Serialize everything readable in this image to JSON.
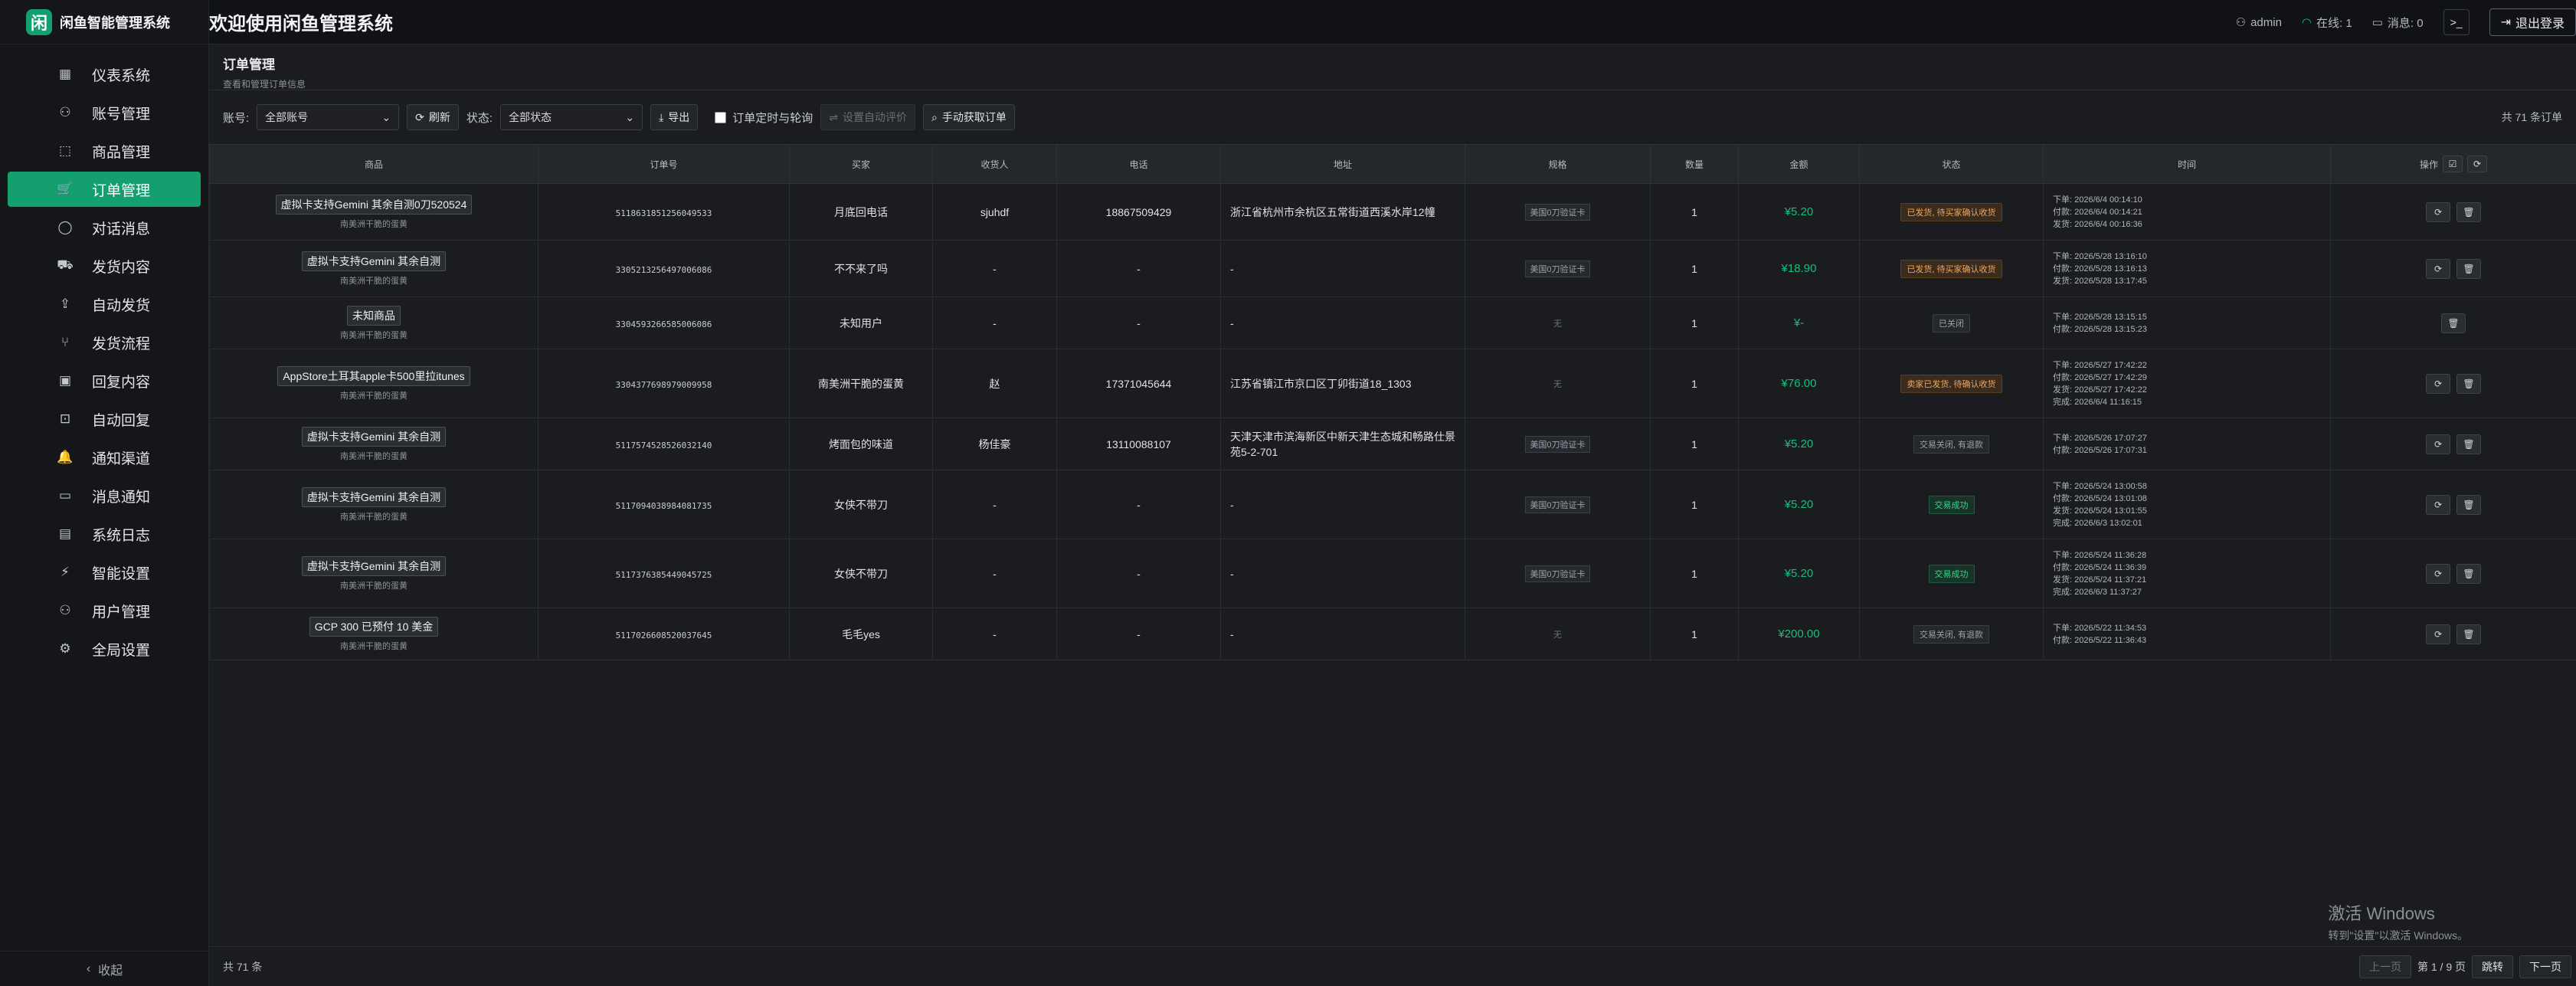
{
  "brand": {
    "logo_char": "闲",
    "name": "闲鱼智能管理系统"
  },
  "sidebar": {
    "items": [
      {
        "label": "仪表系统",
        "icon": "dashboard-icon",
        "glyph": "▦"
      },
      {
        "label": "账号管理",
        "icon": "user-icon",
        "glyph": "⚇"
      },
      {
        "label": "商品管理",
        "icon": "box-icon",
        "glyph": "⬚"
      },
      {
        "label": "订单管理",
        "icon": "cart-icon",
        "glyph": "🛒"
      },
      {
        "label": "对话消息",
        "icon": "chat-icon",
        "glyph": "◯"
      },
      {
        "label": "发货内容",
        "icon": "truck-icon",
        "glyph": "⛟"
      },
      {
        "label": "自动发货",
        "icon": "upload-icon",
        "glyph": "⇪"
      },
      {
        "label": "发货流程",
        "icon": "flow-icon",
        "glyph": "⑂"
      },
      {
        "label": "回复内容",
        "icon": "image-icon",
        "glyph": "▣"
      },
      {
        "label": "自动回复",
        "icon": "bot-icon",
        "glyph": "⊡"
      },
      {
        "label": "通知渠道",
        "icon": "bell-icon",
        "glyph": "🔔"
      },
      {
        "label": "消息通知",
        "icon": "message-icon",
        "glyph": "▭"
      },
      {
        "label": "系统日志",
        "icon": "log-icon",
        "glyph": "▤"
      },
      {
        "label": "智能设置",
        "icon": "bolt-icon",
        "glyph": "⚡"
      },
      {
        "label": "用户管理",
        "icon": "users-icon",
        "glyph": "⚇"
      },
      {
        "label": "全局设置",
        "icon": "gear-icon",
        "glyph": "⚙"
      }
    ],
    "active_index": 3,
    "collapse_label": "收起"
  },
  "topbar": {
    "welcome": "欢迎使用闲鱼管理系统",
    "user": "admin",
    "online": "在线: 1",
    "messages": "消息: 0",
    "terminal_glyph": ">_",
    "logout": "退出登录"
  },
  "page": {
    "title": "订单管理",
    "subtitle": "查看和管理订单信息"
  },
  "toolbar": {
    "account_label": "账号:",
    "account_value": "全部账号",
    "refresh": "刷新",
    "status_label": "状态:",
    "status_value": "全部状态",
    "export": "导出",
    "auto_poll": "订单定时与轮询",
    "auto_review": "设置自动评价",
    "manual_fetch": "手动获取订单",
    "total": "共 71 条订单"
  },
  "table": {
    "headers": [
      "商品",
      "订单号",
      "买家",
      "收货人",
      "电话",
      "地址",
      "规格",
      "数量",
      "金额",
      "状态",
      "时间",
      "操作"
    ],
    "rows": [
      {
        "product": "虚拟卡支持Gemini 其余自测0刀520524",
        "sub": "南美洲干脆的蛋黄",
        "order": "5118631851256049533",
        "buyer": "月底回电话",
        "receiver": "sjuhdf",
        "phone": "18867509429",
        "address": "浙江省杭州市余杭区五常街道西溪水岸12幢",
        "spec": "美国0刀验证卡",
        "qty": "1",
        "amount": "¥5.20",
        "status": "已发货, 待买家确认收货",
        "status_type": "orange",
        "times": [
          "下单: 2026/6/4 00:14:10",
          "付款: 2026/6/4 00:14:21",
          "发货: 2026/6/4 00:16:36"
        ],
        "ops": 2
      },
      {
        "product": "虚拟卡支持Gemini 其余自测",
        "sub": "南美洲干脆的蛋黄",
        "order": "3305213256497006086",
        "buyer": "不不来了吗",
        "receiver": "-",
        "phone": "-",
        "address": "-",
        "spec": "美国0刀验证卡",
        "qty": "1",
        "amount": "¥18.90",
        "status": "已发货, 待买家确认收货",
        "status_type": "orange",
        "times": [
          "下单: 2026/5/28 13:16:10",
          "付款: 2026/5/28 13:16:13",
          "发货: 2026/5/28 13:17:45"
        ],
        "ops": 2
      },
      {
        "product": "未知商品",
        "sub": "南美洲干脆的蛋黄",
        "order": "3304593266585006086",
        "buyer": "未知用户",
        "receiver": "-",
        "phone": "-",
        "address": "-",
        "spec": "",
        "spec_none": "无",
        "qty": "1",
        "amount": "¥-",
        "status": "已关闭",
        "status_type": "gray",
        "times": [
          "下单: 2026/5/28 13:15:15",
          "付款: 2026/5/28 13:15:23"
        ],
        "ops": 1
      },
      {
        "product": "AppStore土耳其apple卡500里拉itunes",
        "sub": "南美洲干脆的蛋黄",
        "order": "3304377698979009958",
        "buyer": "南美洲干脆的蛋黄",
        "receiver": "赵",
        "phone": "17371045644",
        "address": "江苏省镇江市京口区丁卯街道18_1303",
        "spec": "",
        "spec_none": "无",
        "qty": "1",
        "amount": "¥76.00",
        "status": "卖家已发货, 待确认收货",
        "status_type": "orange",
        "times": [
          "下单: 2026/5/27 17:42:22",
          "付款: 2026/5/27 17:42:29",
          "发货: 2026/5/27 17:42:22",
          "完成: 2026/6/4 11:16:15"
        ],
        "ops": 2
      },
      {
        "product": "虚拟卡支持Gemini 其余自测",
        "sub": "南美洲干脆的蛋黄",
        "order": "5117574528526032140",
        "buyer": "烤面包的味道",
        "receiver": "杨佳豪",
        "phone": "13110088107",
        "address": "天津天津市滨海新区中新天津生态城和畅路仕景苑5-2-701",
        "spec": "美国0刀验证卡",
        "qty": "1",
        "amount": "¥5.20",
        "status": "交易关闭, 有退款",
        "status_type": "gray",
        "times": [
          "下单: 2026/5/26 17:07:27",
          "付款: 2026/5/26 17:07:31"
        ],
        "ops": 2
      },
      {
        "product": "虚拟卡支持Gemini 其余自测",
        "sub": "南美洲干脆的蛋黄",
        "order": "5117094038984081735",
        "buyer": "女侠不带刀",
        "receiver": "-",
        "phone": "-",
        "address": "-",
        "spec": "美国0刀验证卡",
        "qty": "1",
        "amount": "¥5.20",
        "status": "交易成功",
        "status_type": "green",
        "times": [
          "下单: 2026/5/24 13:00:58",
          "付款: 2026/5/24 13:01:08",
          "发货: 2026/5/24 13:01:55",
          "完成: 2026/6/3 13:02:01"
        ],
        "ops": 2
      },
      {
        "product": "虚拟卡支持Gemini 其余自测",
        "sub": "南美洲干脆的蛋黄",
        "order": "5117376385449045725",
        "buyer": "女侠不带刀",
        "receiver": "-",
        "phone": "-",
        "address": "-",
        "spec": "美国0刀验证卡",
        "qty": "1",
        "amount": "¥5.20",
        "status": "交易成功",
        "status_type": "green",
        "times": [
          "下单: 2026/5/24 11:36:28",
          "付款: 2026/5/24 11:36:39",
          "发货: 2026/5/24 11:37:21",
          "完成: 2026/6/3 11:37:27"
        ],
        "ops": 2
      },
      {
        "product": "GCP 300 已预付 10 美金",
        "sub": "南美洲干脆的蛋黄",
        "order": "5117026608520037645",
        "buyer": "毛毛yes",
        "receiver": "-",
        "phone": "-",
        "address": "-",
        "spec": "",
        "spec_none": "无",
        "qty": "1",
        "amount": "¥200.00",
        "status": "交易关闭, 有退款",
        "status_type": "gray",
        "times": [
          "下单: 2026/5/22 11:34:53",
          "付款: 2026/5/22 11:36:43"
        ],
        "ops": 2
      }
    ]
  },
  "footer": {
    "total": "共 71 条",
    "prev": "上一页",
    "page_info": "第 1 / 9 页",
    "jump": "跳转",
    "next": "下一页"
  },
  "watermark": {
    "line1": "激活 Windows",
    "line2": "转到\"设置\"以激活 Windows。"
  }
}
